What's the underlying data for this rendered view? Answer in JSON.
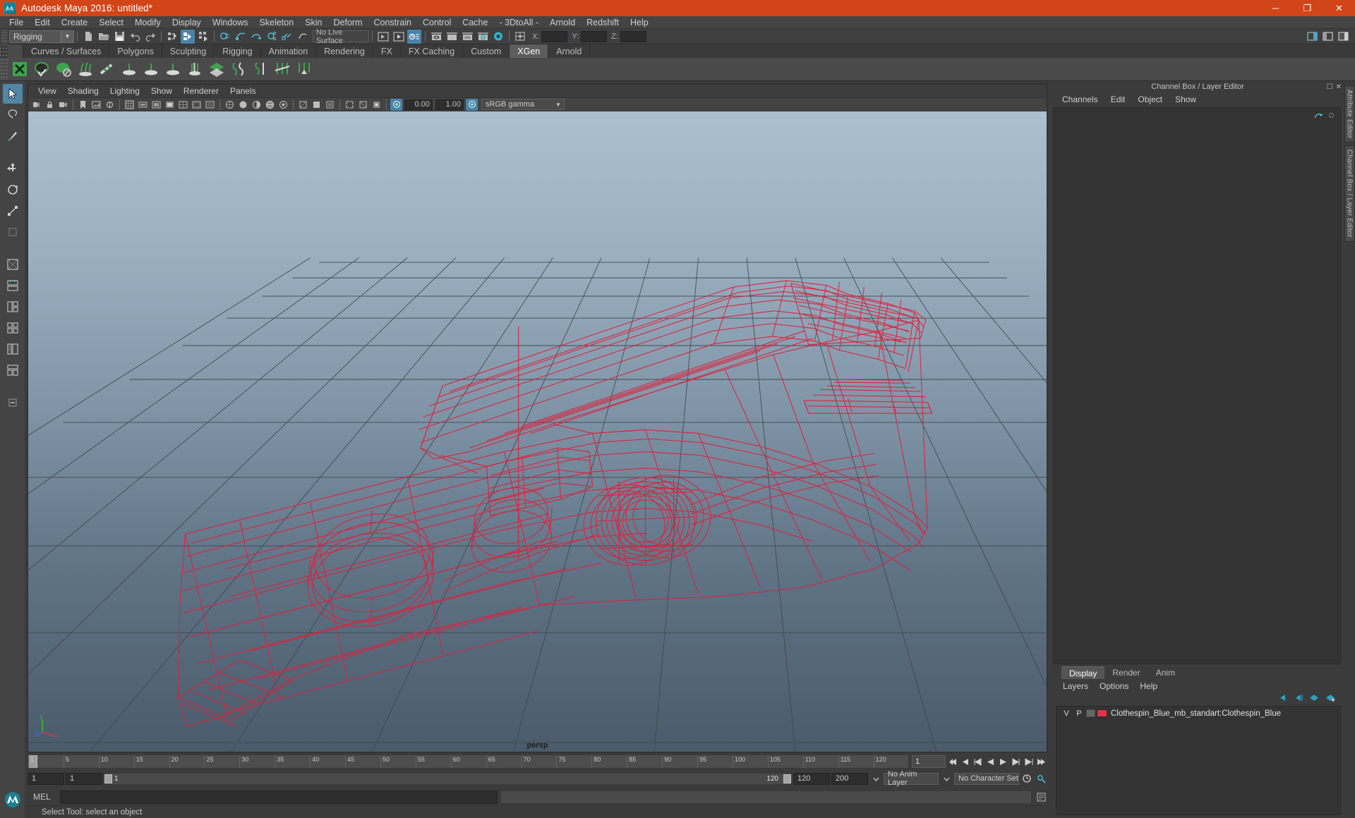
{
  "window": {
    "title": "Autodesk Maya 2016: untitled*",
    "minimize": "─",
    "maximize": "❐",
    "close": "✕",
    "accent_color": "#d14519"
  },
  "menubar": {
    "items": [
      {
        "label": "File"
      },
      {
        "label": "Edit"
      },
      {
        "label": "Create"
      },
      {
        "label": "Select"
      },
      {
        "label": "Modify"
      },
      {
        "label": "Display"
      },
      {
        "label": "Windows"
      },
      {
        "label": "Skeleton"
      },
      {
        "label": "Skin"
      },
      {
        "label": "Deform"
      },
      {
        "label": "Constrain"
      },
      {
        "label": "Control"
      },
      {
        "label": "Cache"
      },
      {
        "label": "- 3DtoAll -"
      },
      {
        "label": "Arnold"
      },
      {
        "label": "Redshift"
      },
      {
        "label": "Help"
      }
    ]
  },
  "toolbar": {
    "menuset": "Rigging",
    "live_surface": "No Live Surface",
    "x_label": "X:",
    "y_label": "Y:",
    "z_label": "Z:",
    "x_value": "",
    "y_value": "",
    "z_value": ""
  },
  "shelf": {
    "tabs": [
      {
        "label": "Curves / Surfaces",
        "active": false
      },
      {
        "label": "Polygons",
        "active": false
      },
      {
        "label": "Sculpting",
        "active": false
      },
      {
        "label": "Rigging",
        "active": false
      },
      {
        "label": "Animation",
        "active": false
      },
      {
        "label": "Rendering",
        "active": false
      },
      {
        "label": "FX",
        "active": false
      },
      {
        "label": "FX Caching",
        "active": false
      },
      {
        "label": "Custom",
        "active": false
      },
      {
        "label": "XGen",
        "active": true
      },
      {
        "label": "Arnold",
        "active": false
      }
    ],
    "icons": [
      "xgen-description-icon",
      "xgen-preview-icon",
      "xgen-render-icon",
      "xgen-groom-icon",
      "xgen-guide-icon",
      "xgen-density-icon",
      "xgen-region-icon",
      "xgen-mask-icon",
      "xgen-clump-icon",
      "xgen-layer-icon",
      "xgen-noise-icon",
      "xgen-coil-icon",
      "xgen-cut-icon",
      "xgen-export-icon"
    ]
  },
  "viewport": {
    "menus": [
      {
        "label": "View"
      },
      {
        "label": "Shading"
      },
      {
        "label": "Lighting"
      },
      {
        "label": "Show"
      },
      {
        "label": "Renderer"
      },
      {
        "label": "Panels"
      }
    ],
    "exposure_value": "0.00",
    "gamma_value": "1.00",
    "color_space": "sRGB gamma",
    "camera_label": "persp",
    "axis": {
      "x": "x",
      "y": "y",
      "z": "z"
    },
    "wireframe_color": "#e0203c",
    "grid_color": "#4a4a4a"
  },
  "timeline": {
    "ticks": [
      "1",
      "5",
      "10",
      "15",
      "20",
      "25",
      "30",
      "35",
      "40",
      "45",
      "50",
      "55",
      "60",
      "65",
      "70",
      "75",
      "80",
      "85",
      "90",
      "95",
      "100",
      "105",
      "110",
      "115",
      "120"
    ],
    "current_frame": "1",
    "frame_field": "1",
    "playback_buttons": [
      "go-to-start-icon",
      "step-back-key-icon",
      "step-back-frame-icon",
      "play-backwards-icon",
      "play-forwards-icon",
      "step-forward-frame-icon",
      "step-forward-key-icon",
      "go-to-end-icon"
    ]
  },
  "range_slider": {
    "anim_start": "1",
    "range_start": "1",
    "bar_start_label": "1",
    "bar_end_label": "120",
    "range_end": "120",
    "anim_end": "200",
    "anim_layer": "No Anim Layer",
    "character_set": "No Character Set",
    "auto_key_icon": "auto-keyframe-icon",
    "anim_prefs_icon": "animation-preferences-icon"
  },
  "command_line": {
    "language_label": "MEL",
    "input_value": "",
    "output_value": ""
  },
  "status_bar": {
    "message": "Select Tool: select an object"
  },
  "channel_box": {
    "panel_title": "Channel Box / Layer Editor",
    "menus": [
      {
        "label": "Channels"
      },
      {
        "label": "Edit"
      },
      {
        "label": "Object"
      },
      {
        "label": "Show"
      }
    ]
  },
  "layer_editor": {
    "tabs": [
      {
        "label": "Display",
        "active": true
      },
      {
        "label": "Render",
        "active": false
      },
      {
        "label": "Anim",
        "active": false
      }
    ],
    "menus": [
      {
        "label": "Layers"
      },
      {
        "label": "Options"
      },
      {
        "label": "Help"
      }
    ],
    "column_v": "V",
    "column_p": "P",
    "layers": [
      {
        "visible": "V",
        "playback": "P",
        "color": "#e0344a",
        "name": "Clothespin_Blue_mb_standart:Clothespin_Blue"
      }
    ]
  },
  "right_vertical_tabs": [
    {
      "label": "Attribute Editor"
    },
    {
      "label": "Channel Box / Layer Editor"
    }
  ],
  "left_toolbox": {
    "items": [
      {
        "name": "select-tool-icon",
        "selected": true
      },
      {
        "name": "lasso-tool-icon",
        "selected": false
      },
      {
        "name": "paint-select-tool-icon",
        "selected": false
      },
      {
        "name": "move-tool-icon",
        "selected": false
      },
      {
        "name": "rotate-tool-icon",
        "selected": false
      },
      {
        "name": "scale-tool-icon",
        "selected": false
      },
      {
        "name": "last-tool-icon",
        "selected": false
      },
      {
        "name": "layout-single-icon",
        "selected": false
      },
      {
        "name": "layout-two-pane-icon",
        "selected": false
      },
      {
        "name": "layout-three-pane-icon",
        "selected": false
      },
      {
        "name": "layout-four-pane-icon",
        "selected": false
      },
      {
        "name": "layout-persp-outliner-icon",
        "selected": false
      },
      {
        "name": "layout-hypergraph-icon",
        "selected": false
      },
      {
        "name": "layout-more-icon",
        "selected": false
      }
    ]
  }
}
